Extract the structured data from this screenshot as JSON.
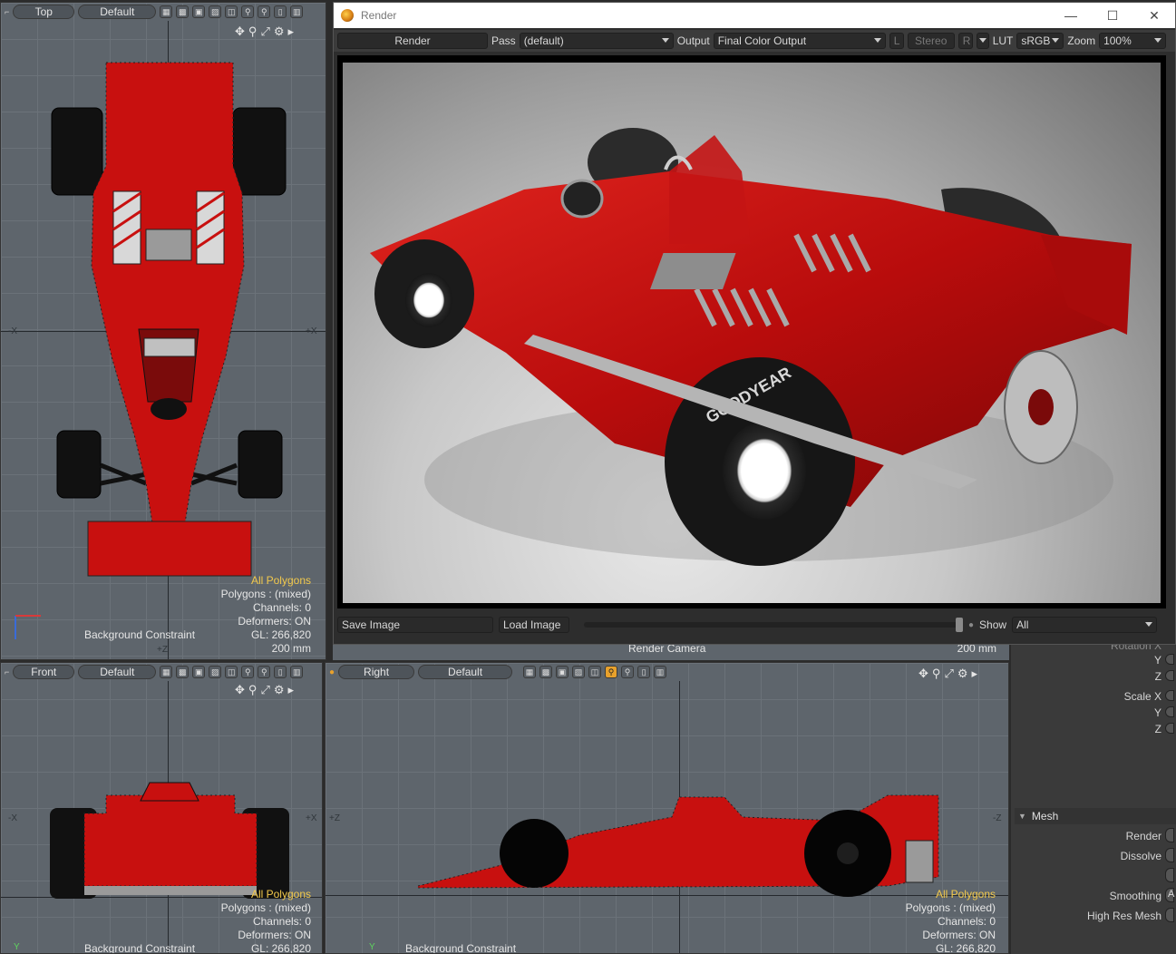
{
  "viewports": {
    "top": {
      "view_label": "Top",
      "shading_label": "Default",
      "axis_neg_x": "-X",
      "axis_pos_x": "+X",
      "axis_z": "+Z",
      "stats": {
        "selection": "All Polygons",
        "polygons": "Polygons : (mixed)",
        "channels": "Channels: 0",
        "deformers": "Deformers: ON",
        "gl": "GL: 266,820",
        "scale": "200 mm"
      },
      "bg_constraint": "Background Constraint"
    },
    "front": {
      "view_label": "Front",
      "shading_label": "Default",
      "axis_neg_x": "-X",
      "axis_pos_x": "+X",
      "stats": {
        "selection": "All Polygons",
        "polygons": "Polygons : (mixed)",
        "channels": "Channels: 0",
        "deformers": "Deformers: ON",
        "gl": "GL: 266,820"
      },
      "bg_constraint": "Background Constraint",
      "axis_y": "Y"
    },
    "right": {
      "view_label": "Right",
      "shading_label": "Default",
      "axis_pos_z": "+Z",
      "axis_neg_z": "-Z",
      "stats": {
        "selection": "All Polygons",
        "polygons": "Polygons : (mixed)",
        "channels": "Channels: 0",
        "deformers": "Deformers: ON",
        "gl": "GL: 266,820"
      },
      "bg_constraint": "Background Constraint",
      "axis_y": "Y"
    },
    "camera": {
      "label": "Render Camera",
      "scale": "200 mm"
    }
  },
  "render_window": {
    "title": "Render",
    "controls": {
      "minimize": "—",
      "maximize": "☐",
      "close": "✕"
    },
    "toolbar": {
      "render_label": "Render",
      "pass_label": "Pass",
      "pass_value": "(default)",
      "output_label": "Output",
      "output_value": "Final Color Output",
      "l_label": "L",
      "stereo_label": "Stereo",
      "r_label": "R",
      "lut_label": "LUT",
      "lut_value": "sRGB",
      "zoom_label": "Zoom",
      "zoom_value": "100%"
    },
    "bottom": {
      "save_label": "Save Image",
      "load_label": "Load Image",
      "show_label": "Show",
      "show_value": "All"
    },
    "tire_brand": "GOODYEAR"
  },
  "properties": {
    "rotation_label": "Rotation X",
    "rot_y": "Y",
    "rot_z": "Z",
    "scale_x": "Scale X",
    "scale_y": "Y",
    "scale_z": "Z",
    "mesh_section": "Mesh",
    "render": "Render",
    "dissolve": "Dissolve",
    "smoothing": "Smoothing",
    "smoothing_value": "A",
    "high_res": "High Res Mesh"
  },
  "colors": {
    "accent": "#e8a12c",
    "car_red": "#c8100f",
    "viewport_bg": "#5e656c",
    "highlight_text": "#f2c94c"
  }
}
